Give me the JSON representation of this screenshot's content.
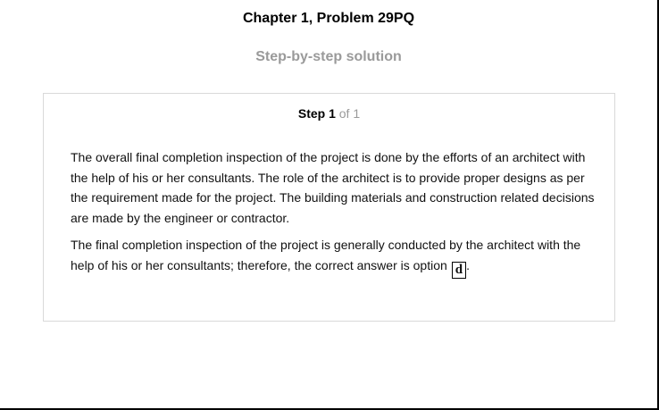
{
  "header": {
    "title": "Chapter 1, Problem 29PQ",
    "subtitle": "Step-by-step solution"
  },
  "step": {
    "label": "Step 1",
    "of_text": " of 1",
    "paragraph_1": "The overall final completion inspection of the project is done by the efforts of an architect with the help of his or her consultants. The role of the architect is to provide proper designs as per the requirement made for the project. The building materials and construction related decisions are made by the engineer or contractor.",
    "paragraph_2": "The final completion inspection of the project is generally conducted by the architect with the help of his or her consultants; therefore, the correct answer is option",
    "answer": "d",
    "trailing": "."
  }
}
